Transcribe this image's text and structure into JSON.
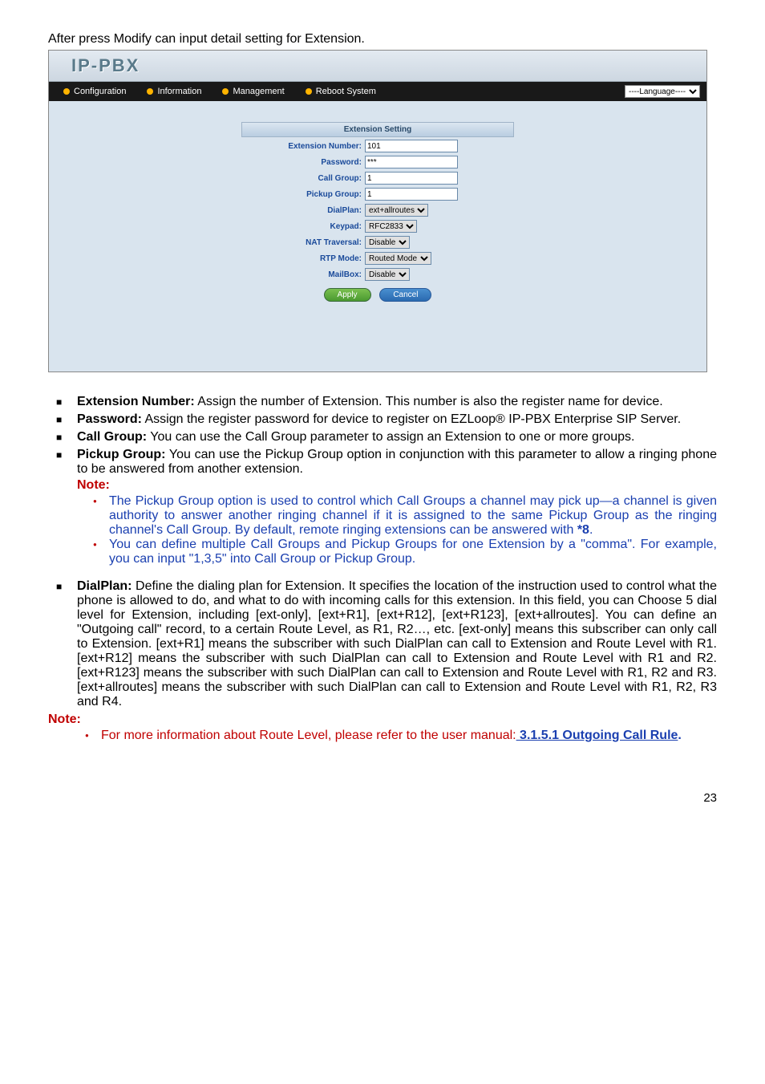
{
  "intro": "After press Modify can input detail setting for Extension.",
  "shot": {
    "logo": "IP-PBX",
    "menu": {
      "conf": "Configuration",
      "info": "Information",
      "mgmt": "Management",
      "reboot": "Reboot System"
    },
    "lang": "----Language----",
    "header": "Extension Setting",
    "rows": {
      "extnum_l": "Extension Number:",
      "extnum_v": "101",
      "pass_l": "Password:",
      "pass_v": "***",
      "callg_l": "Call Group:",
      "callg_v": "1",
      "pickg_l": "Pickup Group:",
      "pickg_v": "1",
      "dial_l": "DialPlan:",
      "dial_v": "ext+allroutes",
      "key_l": "Keypad:",
      "key_v": "RFC2833",
      "nat_l": "NAT Traversal:",
      "nat_v": "Disable",
      "rtp_l": "RTP Mode:",
      "rtp_v": "Routed Mode",
      "mail_l": "MailBox:",
      "mail_v": "Disable"
    },
    "apply": "Apply",
    "cancel": "Cancel"
  },
  "items": {
    "ext_b": "Extension Number:",
    "ext_t": " Assign the number of Extension. This number is also the register name for device.",
    "pw_b": "Password:",
    "pw_t": " Assign the register password for device to register on EZLoop® IP-PBX Enterprise SIP Server.",
    "cg_b": "Call Group:",
    "cg_t": " You can use the Call Group parameter to assign an Extension to one or more groups.",
    "pg_b": "Pickup Group:",
    "pg_t": " You can use the Pickup Group option in conjunction with this parameter to allow a ringing phone to be answered from another extension.",
    "note1": "Note:",
    "pg_n1": "The Pickup Group option is used to control which Call Groups a channel may pick up—a channel is given authority to answer another ringing channel if it is assigned to the same Pickup Group as the ringing channel's Call Group. By default, remote ringing extensions can be answered with ",
    "pg_n1_star": "*8",
    "pg_n1_dot": ".",
    "pg_n2": "You can define multiple Call Groups and Pickup Groups for one Extension by a \"comma\". For example, you can input \"1,3,5\" into Call Group or Pickup Group.",
    "dp_b": "DialPlan:",
    "dp_t": " Define the dialing plan for Extension. It specifies the location of the instruction used to control what the phone is allowed to do, and what to do with incoming calls for this extension. In this field, you can Choose 5 dial level for Extension, including [ext-only], [ext+R1], [ext+R12], [ext+R123], [ext+allroutes]. You can define an \"Outgoing call\" record, to a certain Route Level, as R1, R2…, etc. [ext-only] means this subscriber can only call to Extension. [ext+R1] means the subscriber with such DialPlan can call to Extension and Route Level with R1. [ext+R12] means the subscriber with such DialPlan can call to Extension and Route Level with R1 and R2. [ext+R123] means the subscriber with such DialPlan can call to Extension and Route Level with R1, R2 and R3. [ext+allroutes] means the subscriber with such DialPlan can call to Extension and Route Level with R1, R2, R3 and R4."
  },
  "footer": {
    "note": "Note:",
    "line_pre": "For more information about Route Level, please refer to the user manual:",
    "link": " 3.1.5.1 Outgoing Call Rule",
    "dot": "."
  },
  "pagenum": "23"
}
